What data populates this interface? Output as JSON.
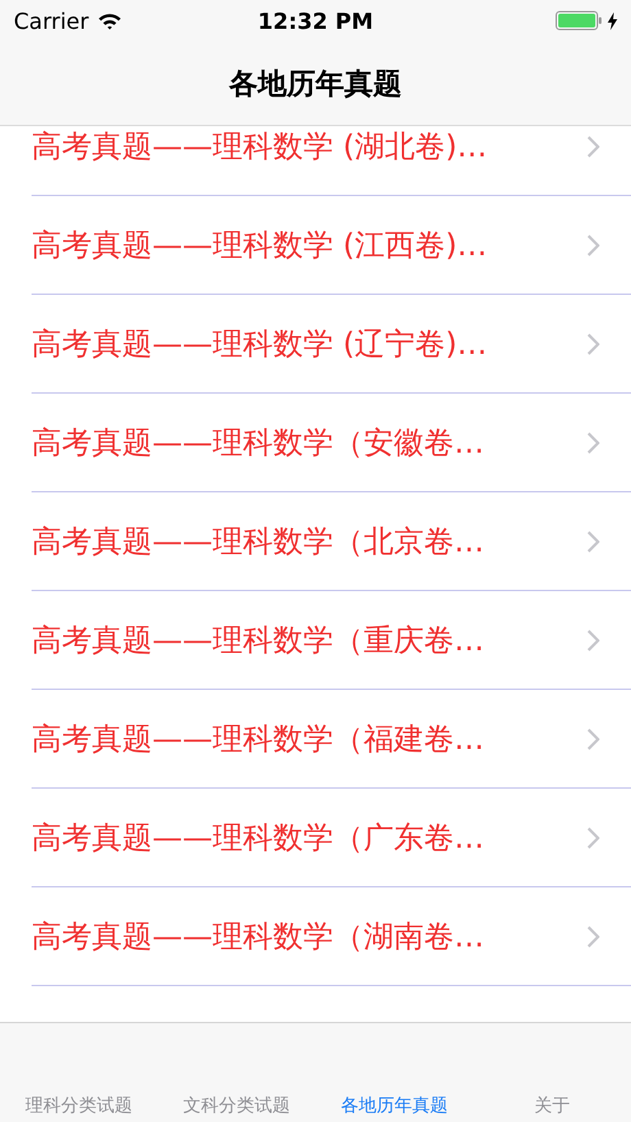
{
  "status_bar": {
    "carrier": "Carrier",
    "time": "12:32 PM",
    "battery": {
      "level": 1,
      "charging": true
    }
  },
  "nav_bar": {
    "title": "各地历年真题"
  },
  "list": [
    {
      "title": "高考真题——理科数学 (湖北卷)…"
    },
    {
      "title": "高考真题——理科数学 (江西卷)…"
    },
    {
      "title": "高考真题——理科数学 (辽宁卷)…"
    },
    {
      "title": "高考真题——理科数学（安徽卷…"
    },
    {
      "title": "高考真题——理科数学（北京卷…"
    },
    {
      "title": "高考真题——理科数学（重庆卷…"
    },
    {
      "title": "高考真题——理科数学（福建卷…"
    },
    {
      "title": "高考真题——理科数学（广东卷…"
    },
    {
      "title": "高考真题——理科数学（湖南卷…"
    }
  ],
  "tab_bar": [
    {
      "label": "理科分类试题",
      "selected": false
    },
    {
      "label": "文科分类试题",
      "selected": false
    },
    {
      "label": "各地历年真题",
      "selected": true
    },
    {
      "label": "关于",
      "selected": false
    }
  ]
}
